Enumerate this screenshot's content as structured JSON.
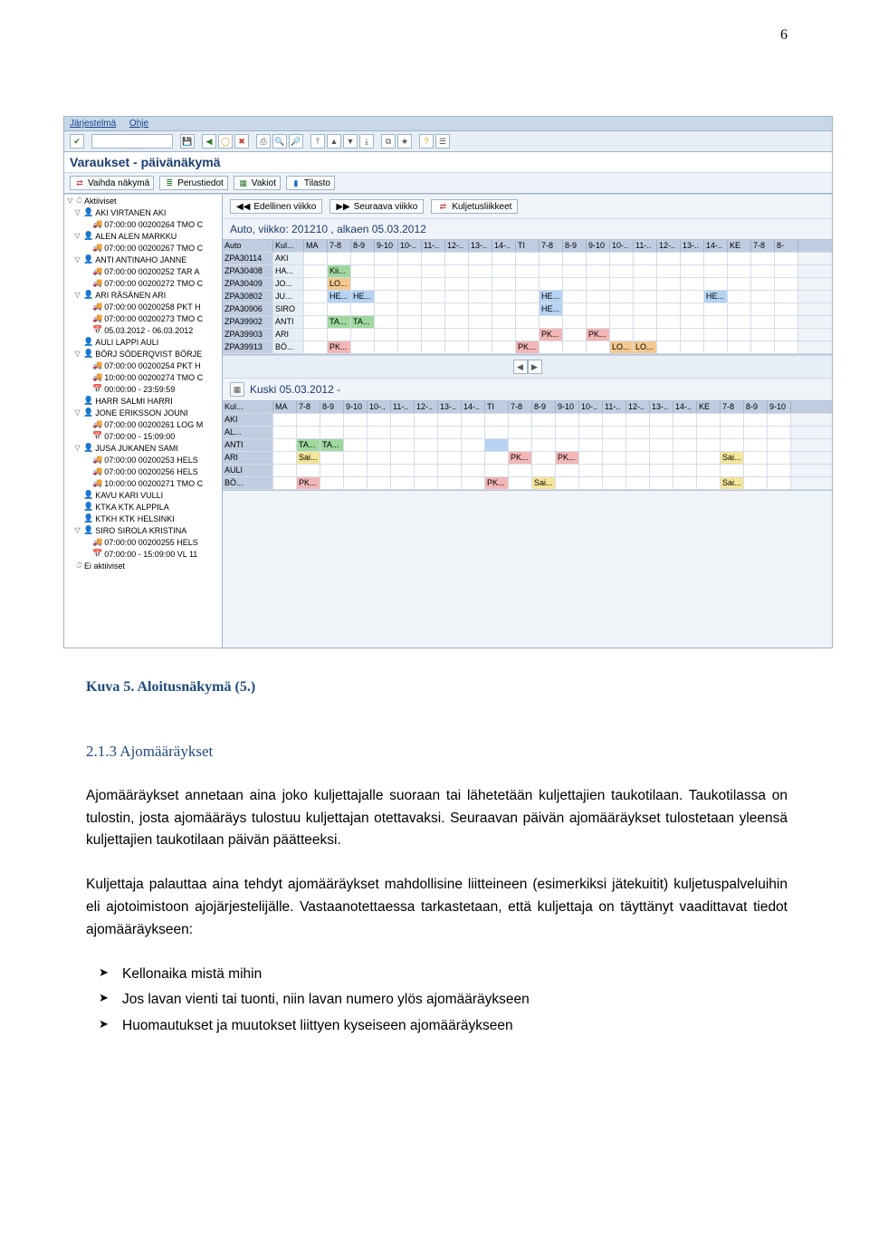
{
  "page_number": "6",
  "menu": {
    "item1": "Järjestelmä",
    "item2": "Ohje"
  },
  "window_title": "Varaukset - päivänäkymä",
  "view_toolbar": {
    "change_view": "Vaihda näkymä",
    "basic_info": "Perustiedot",
    "constants": "Vakiot",
    "statistics": "Tilasto"
  },
  "tree": [
    {
      "indent": 0,
      "toggle": "▽",
      "icon": "clock",
      "text": "Aktiiviset"
    },
    {
      "indent": 1,
      "toggle": "▽",
      "icon": "person",
      "text": "AKI VIRTANEN AKI"
    },
    {
      "indent": 2,
      "toggle": "",
      "icon": "truck",
      "text": "07:00:00 00200264 TMO C"
    },
    {
      "indent": 1,
      "toggle": "▽",
      "icon": "person",
      "text": "ALEN ALEN MARKKU"
    },
    {
      "indent": 2,
      "toggle": "",
      "icon": "truck",
      "text": "07:00:00 00200267 TMO C"
    },
    {
      "indent": 1,
      "toggle": "▽",
      "icon": "person",
      "text": "ANTI ANTINAHO JANNE"
    },
    {
      "indent": 2,
      "toggle": "",
      "icon": "truck",
      "text": "07:00:00 00200252 TAR A"
    },
    {
      "indent": 2,
      "toggle": "",
      "icon": "truck",
      "text": "07:00:00 00200272 TMO C"
    },
    {
      "indent": 1,
      "toggle": "▽",
      "icon": "person",
      "text": "ARI RÄSÄNEN ARI"
    },
    {
      "indent": 2,
      "toggle": "",
      "icon": "truck",
      "text": "07:00:00 00200258 PKT H"
    },
    {
      "indent": 2,
      "toggle": "",
      "icon": "truck",
      "text": "07:00:00 00200273 TMO C"
    },
    {
      "indent": 2,
      "toggle": "",
      "icon": "cal",
      "text": "05.03.2012 - 06.03.2012"
    },
    {
      "indent": 1,
      "toggle": "",
      "icon": "person",
      "text": "AULI LAPPI AULI"
    },
    {
      "indent": 1,
      "toggle": "▽",
      "icon": "person",
      "text": "BÖRJ SÖDERQVIST BÖRJE"
    },
    {
      "indent": 2,
      "toggle": "",
      "icon": "truck",
      "text": "07:00:00 00200254 PKT H"
    },
    {
      "indent": 2,
      "toggle": "",
      "icon": "truck",
      "text": "10:00:00 00200274 TMO C"
    },
    {
      "indent": 2,
      "toggle": "",
      "icon": "cal",
      "text": "00:00:00 - 23:59:59"
    },
    {
      "indent": 1,
      "toggle": "",
      "icon": "person",
      "text": "HARR SALMI HARRI"
    },
    {
      "indent": 1,
      "toggle": "▽",
      "icon": "person",
      "text": "JONE ERIKSSON JOUNI"
    },
    {
      "indent": 2,
      "toggle": "",
      "icon": "truck",
      "text": "07:00:00 00200261 LOG M"
    },
    {
      "indent": 2,
      "toggle": "",
      "icon": "cal",
      "text": "07:00:00 - 15:09:00"
    },
    {
      "indent": 1,
      "toggle": "▽",
      "icon": "person",
      "text": "JUSA JUKANEN SAMI"
    },
    {
      "indent": 2,
      "toggle": "",
      "icon": "truck",
      "text": "07:00:00 00200253 HELS"
    },
    {
      "indent": 2,
      "toggle": "",
      "icon": "truck",
      "text": "07:00:00 00200256 HELS"
    },
    {
      "indent": 2,
      "toggle": "",
      "icon": "truck",
      "text": "10:00:00 00200271 TMO C"
    },
    {
      "indent": 1,
      "toggle": "",
      "icon": "person",
      "text": "KAVU KARI VULLI"
    },
    {
      "indent": 1,
      "toggle": "",
      "icon": "person",
      "text": "KTKA KTK ALPPILA"
    },
    {
      "indent": 1,
      "toggle": "",
      "icon": "person",
      "text": "KTKH KTK HELSINKI"
    },
    {
      "indent": 1,
      "toggle": "▽",
      "icon": "person",
      "text": "SIRO SIROLA KRISTINA"
    },
    {
      "indent": 2,
      "toggle": "",
      "icon": "truck",
      "text": "07:00:00 00200255 HELS"
    },
    {
      "indent": 2,
      "toggle": "",
      "icon": "cal",
      "text": "07:00:00 - 15:09:00 VL 11"
    },
    {
      "indent": 0,
      "toggle": "",
      "icon": "clock",
      "text": "Ei aktiiviset"
    }
  ],
  "week_nav": {
    "prev": "Edellinen viikko",
    "next": "Seuraava viikko",
    "carriers": "Kuljetusliikkeet"
  },
  "auto_title": "Auto, viikko: 201210 , alkaen 05.03.2012",
  "auto_columns": [
    "Auto",
    "Kul...",
    "MA",
    "7-8",
    "8-9",
    "9-10",
    "10-..",
    "11-..",
    "12-..",
    "13-..",
    "14-..",
    "TI",
    "7-8",
    "8-9",
    "9-10",
    "10-..",
    "11-..",
    "12-..",
    "13-..",
    "14-..",
    "KE",
    "7-8",
    "8-"
  ],
  "auto_rows": [
    {
      "code": "ZPA30114",
      "name": "AKI",
      "cells": []
    },
    {
      "code": "ZPA30408",
      "name": "HA...",
      "cells": [
        {
          "col": 3,
          "txt": "Kii...",
          "cls": "cell-green"
        }
      ]
    },
    {
      "code": "ZPA30409",
      "name": "JO...",
      "cells": [
        {
          "col": 3,
          "txt": "LO...",
          "cls": "cell-orange"
        }
      ]
    },
    {
      "code": "ZPA30802",
      "name": "JU...",
      "cells": [
        {
          "col": 3,
          "txt": "HE...",
          "cls": "cell-blue"
        },
        {
          "col": 4,
          "txt": "HE...",
          "cls": "cell-blue"
        },
        {
          "col": 12,
          "txt": "HE...",
          "cls": "cell-blue"
        },
        {
          "col": 19,
          "txt": "HE...",
          "cls": "cell-blue"
        }
      ]
    },
    {
      "code": "ZPA30906",
      "name": "SIRO",
      "cells": [
        {
          "col": 12,
          "txt": "HE...",
          "cls": "cell-blue"
        }
      ]
    },
    {
      "code": "ZPA39902",
      "name": "ANTI",
      "cells": [
        {
          "col": 3,
          "txt": "TA...",
          "cls": "cell-green"
        },
        {
          "col": 4,
          "txt": "TA...",
          "cls": "cell-green"
        }
      ]
    },
    {
      "code": "ZPA39903",
      "name": "ARI",
      "cells": [
        {
          "col": 12,
          "txt": "PK...",
          "cls": "cell-pink"
        },
        {
          "col": 14,
          "txt": "PK...",
          "cls": "cell-pink"
        }
      ]
    },
    {
      "code": "ZPA39913",
      "name": "BÖ...",
      "cells": [
        {
          "col": 3,
          "txt": "PK...",
          "cls": "cell-pink"
        },
        {
          "col": 11,
          "txt": "PK...",
          "cls": "cell-pink"
        },
        {
          "col": 15,
          "txt": "LO...",
          "cls": "cell-orange"
        },
        {
          "col": 16,
          "txt": "LO...",
          "cls": "cell-orange"
        }
      ]
    }
  ],
  "kuski_title": "Kuski 05.03.2012 -",
  "kuski_columns": [
    "Kul...",
    "MA",
    "7-8",
    "8-9",
    "9-10",
    "10-..",
    "11-..",
    "12-..",
    "13-..",
    "14-..",
    "TI",
    "7-8",
    "8-9",
    "9-10",
    "10-..",
    "11-..",
    "12-..",
    "13-..",
    "14-..",
    "KE",
    "7-8",
    "8-9",
    "9-10"
  ],
  "kuski_rows": [
    {
      "name": "AKI",
      "cells": []
    },
    {
      "name": "AL...",
      "cells": []
    },
    {
      "name": "ANTI",
      "cells": [
        {
          "col": 2,
          "txt": "TA...",
          "cls": "cell-green"
        },
        {
          "col": 3,
          "txt": "TA...",
          "cls": "cell-green"
        },
        {
          "col": 10,
          "txt": "",
          "cls": "cell-blue"
        }
      ]
    },
    {
      "name": "ARI",
      "cells": [
        {
          "col": 2,
          "txt": "Sai...",
          "cls": "cell-yellow"
        },
        {
          "col": 11,
          "txt": "PK...",
          "cls": "cell-pink"
        },
        {
          "col": 13,
          "txt": "PK...",
          "cls": "cell-pink"
        },
        {
          "col": 20,
          "txt": "Sai...",
          "cls": "cell-yellow"
        }
      ]
    },
    {
      "name": "AULI",
      "cells": []
    },
    {
      "name": "BÖ...",
      "cells": [
        {
          "col": 2,
          "txt": "PK...",
          "cls": "cell-pink"
        },
        {
          "col": 10,
          "txt": "PK...",
          "cls": "cell-pink"
        },
        {
          "col": 12,
          "txt": "Sai...",
          "cls": "cell-yellow"
        },
        {
          "col": 20,
          "txt": "Sai...",
          "cls": "cell-yellow"
        }
      ]
    }
  ],
  "document": {
    "caption": "Kuva 5. Aloitusnäkymä (5.)",
    "heading": "2.1.3 Ajomääräykset",
    "para1": "Ajomääräykset annetaan aina joko kuljettajalle suoraan tai lähetetään kuljettajien taukotilaan. Taukotilassa on tulostin, josta ajomääräys tulostuu kuljettajan otettavaksi. Seuraavan päivän ajomääräykset tulostetaan yleensä kuljettajien taukotilaan päivän päätteeksi.",
    "para2": "Kuljettaja palauttaa aina tehdyt ajomääräykset mahdollisine liitteineen (esimerkiksi jätekuitit) kuljetuspalveluihin eli ajotoimistoon ajojärjestelijälle. Vastaanotettaessa tarkastetaan, että kuljettaja on täyttänyt vaadittavat tiedot ajomääräykseen:",
    "bullets": [
      "Kellonaika mistä mihin",
      "Jos lavan vienti tai tuonti, niin lavan numero ylös ajomääräykseen",
      "Huomautukset ja muutokset liittyen kyseiseen ajomääräykseen"
    ]
  }
}
